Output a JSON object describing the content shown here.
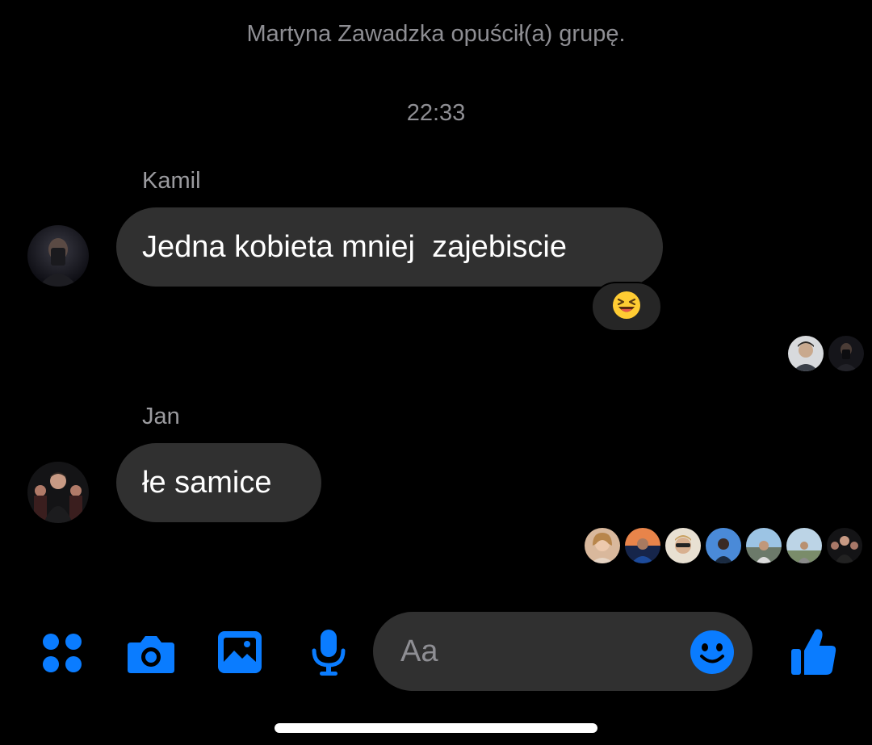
{
  "conversation": {
    "system_message": "Martyna Zawadzka opuścił(a) grupę.",
    "timestamp": "22:33",
    "messages": [
      {
        "sender": "Kamil",
        "text": "Jedna kobieta mniej  zajebiscie",
        "reaction": "laughing-emoji",
        "read_receipts_count": 2
      },
      {
        "sender": "Jan",
        "text": "łe samice",
        "read_receipts_count": 7
      }
    ]
  },
  "composer": {
    "placeholder": "Aa",
    "icons": [
      "menu-grid-icon",
      "camera-icon",
      "gallery-icon",
      "microphone-icon",
      "emoji-icon",
      "thumbs-up-icon"
    ]
  },
  "colors": {
    "background": "#000000",
    "bubble": "#303030",
    "accent": "#0a7cff",
    "muted_text": "#8e8e93"
  }
}
